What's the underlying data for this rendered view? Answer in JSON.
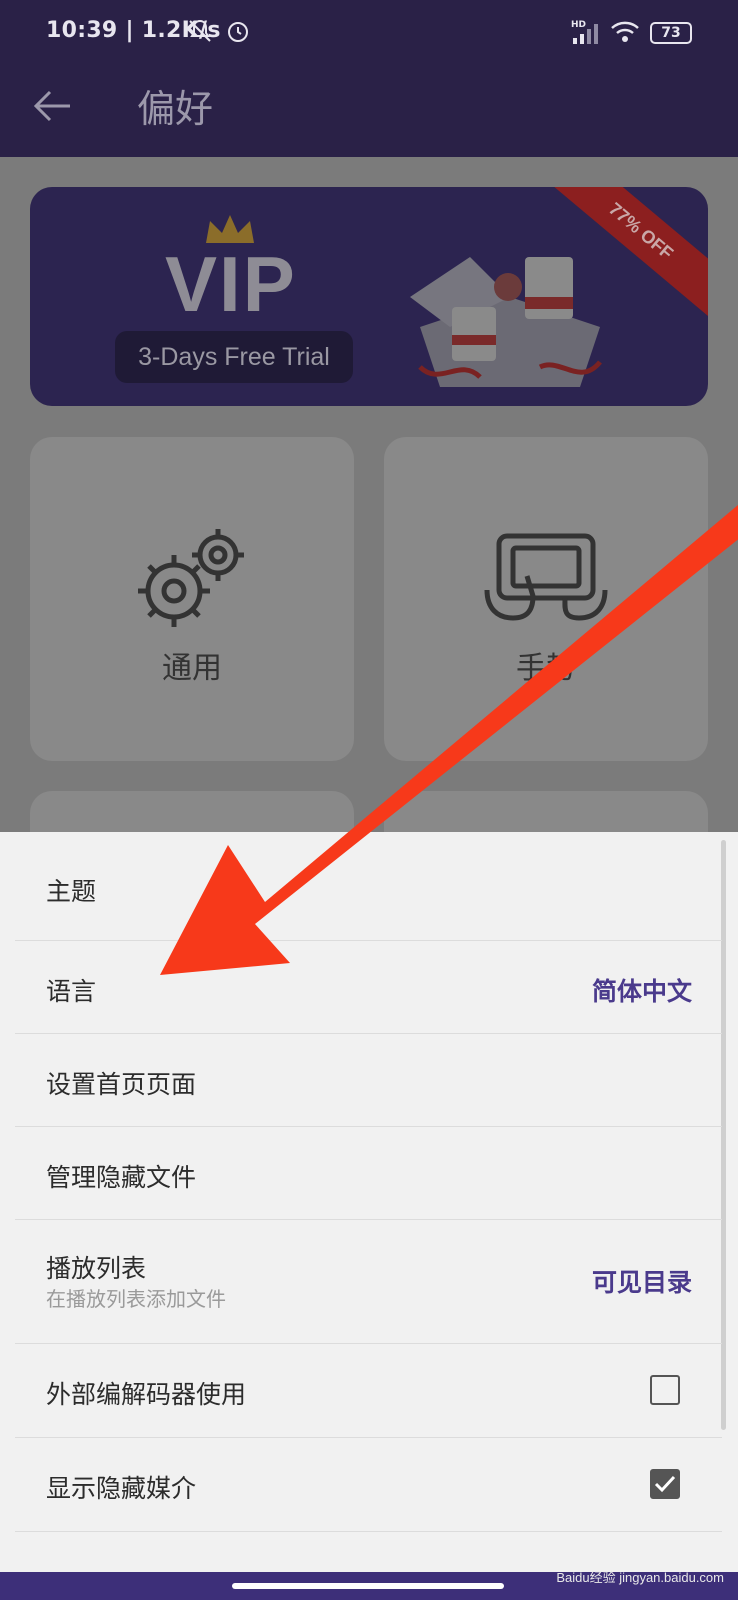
{
  "status_bar": {
    "time_speed": "10:39 | 1.2K/s",
    "battery": "73",
    "network": "HD"
  },
  "app_bar": {
    "title": "偏好"
  },
  "banner": {
    "vip_label": "VIP",
    "trial_label": "3-Days Free Trial",
    "discount": "77% OFF"
  },
  "tiles": [
    {
      "label": "通用",
      "icon": "gear-icon"
    },
    {
      "label": "手势",
      "icon": "gesture-icon"
    }
  ],
  "sheet": {
    "rows": [
      {
        "label": "主题"
      },
      {
        "label": "语言",
        "value": "简体中文"
      },
      {
        "label": "设置首页页面"
      },
      {
        "label": "管理隐藏文件"
      },
      {
        "label": "播放列表",
        "sublabel": "在播放列表添加文件",
        "value": "可见目录"
      },
      {
        "label": "外部编解码器使用",
        "checked": false
      },
      {
        "label": "显示隐藏媒介",
        "checked": true
      }
    ]
  },
  "colors": {
    "accent": "#4a3a8c",
    "appbar": "#2a2147",
    "arrow": "#f7391a"
  },
  "watermark": "Baidu经验 jingyan.baidu.com"
}
